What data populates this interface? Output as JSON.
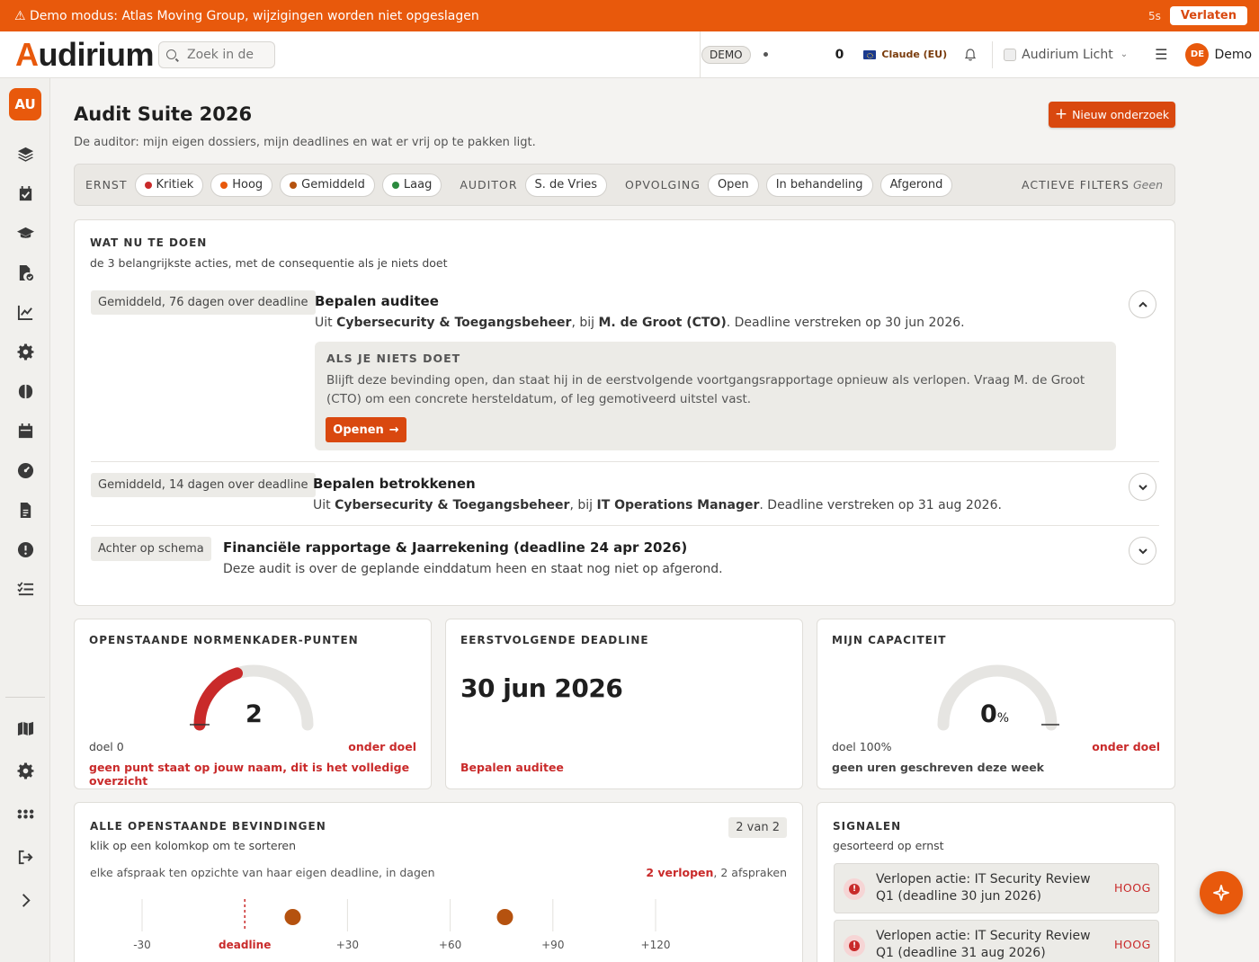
{
  "banner": {
    "message": "⚠ Demo modus: Atlas Moving Group, wijzigingen worden niet opgeslagen",
    "timer": "5s",
    "leave_label": "Verlaten"
  },
  "topbar": {
    "logo_first": "A",
    "logo_rest": "udirium",
    "search_placeholder": "Zoek in de",
    "demo_badge": "DEMO",
    "count": "0",
    "model": "Claude (EU)",
    "theme": "Audirium Licht",
    "user_initials": "DE",
    "user_name": "Demo"
  },
  "sidebar": {
    "badge": "AU",
    "items": [
      "layers-icon",
      "calendar-check-icon",
      "graduation-cap-icon",
      "file-check-icon",
      "chart-line-icon",
      "gear-icon",
      "brain-icon",
      "calendar-icon",
      "gauge-icon",
      "document-icon",
      "alert-circle-icon",
      "list-check-icon"
    ],
    "bottom_items": [
      "map-icon",
      "gear-icon",
      "grid-dots-icon",
      "sign-out-icon",
      "chevron-right-icon"
    ]
  },
  "page": {
    "title": "Audit Suite 2026",
    "subtitle": "De auditor: mijn eigen dossiers, mijn deadlines en wat er vrij op te pakken ligt.",
    "new_button": "Nieuw onderzoek"
  },
  "filters": {
    "severity_label": "ERNST",
    "severity": [
      {
        "label": "Kritiek",
        "color": "#c92a2a"
      },
      {
        "label": "Hoog",
        "color": "#e8590c"
      },
      {
        "label": "Gemiddeld",
        "color": "#b5520f"
      },
      {
        "label": "Laag",
        "color": "#2b8a3e"
      }
    ],
    "auditor_label": "AUDITOR",
    "auditor": "S. de Vries",
    "followup_label": "OPVOLGING",
    "followup": [
      "Open",
      "In behandeling",
      "Afgerond"
    ],
    "active_label": "ACTIEVE FILTERS",
    "active_value": "Geen"
  },
  "todo": {
    "heading": "WAT NU TE DOEN",
    "subheading": "de 3 belangrijkste acties, met de consequentie als je niets doet",
    "items": [
      {
        "tag": "Gemiddeld, 76 dagen over deadline",
        "title": "Bepalen auditee",
        "desc_prefix": "Uit ",
        "desc_source": "Cybersecurity & Toegangsbeheer",
        "desc_mid": ", bij ",
        "desc_owner": "M. de Groot (CTO)",
        "desc_suffix": ". Deadline verstreken op 30 jun 2026."
      },
      {
        "tag": "Gemiddeld, 14 dagen over deadline",
        "title": "Bepalen betrokkenen",
        "desc_prefix": "Uit ",
        "desc_source": "Cybersecurity & Toegangsbeheer",
        "desc_mid": ", bij ",
        "desc_owner": "IT Operations Manager",
        "desc_suffix": ". Deadline verstreken op 31 aug 2026."
      },
      {
        "tag": "Achter op schema",
        "title": "Financiële rapportage & Jaarrekening (deadline 24 apr 2026)",
        "desc": "Deze audit is over de geplande einddatum heen en staat nog niet op afgerond."
      }
    ],
    "consequence_heading": "ALS JE NIETS DOET",
    "consequence_text": "Blijft deze bevinding open, dan staat hij in de eerstvolgende voortgangsrapportage opnieuw als verlopen. Vraag M. de Groot (CTO) om een concrete hersteldatum, of leg gemotiveerd uitstel vast.",
    "open_label": "Openen"
  },
  "metrics": {
    "norms": {
      "heading": "OPENSTAANDE NORMENKADER-PUNTEN",
      "value": "2",
      "gauge_fill": 0.4,
      "goal": "doel 0",
      "status": "onder doel",
      "note": "geen punt staat op jouw naam, dit is het volledige overzicht"
    },
    "deadline": {
      "heading": "EERSTVOLGENDE DEADLINE",
      "value": "30 jun 2026",
      "note": "Bepalen auditee"
    },
    "capacity": {
      "heading": "MIJN CAPACITEIT",
      "value": "0",
      "unit": "%",
      "gauge_fill": 0,
      "goal": "doel 100%",
      "status": "onder doel",
      "note": "geen uren geschreven deze week"
    }
  },
  "findings": {
    "heading": "ALLE OPENSTAANDE BEVINDINGEN",
    "subheading": "klik op een kolomkop om te sorteren",
    "count_badge": "2 van 2",
    "chart_caption": "elke afspraak ten opzichte van haar eigen deadline, in dagen",
    "overdue": "2 verlopen",
    "total": ", 2 afspraken"
  },
  "chart_data": {
    "type": "scatter",
    "x_ticks": [
      -30,
      0,
      30,
      60,
      90,
      120
    ],
    "x_tick_labels": [
      "-30",
      "deadline",
      "+30",
      "+60",
      "+90",
      "+120"
    ],
    "xlim": [
      -30,
      120
    ],
    "points": [
      14,
      76
    ],
    "color": "#b5520f"
  },
  "signals": {
    "heading": "SIGNALEN",
    "subheading": "gesorteerd op ernst",
    "items": [
      {
        "text": "Verlopen actie: IT Security Review Q1 (deadline 30 jun 2026)",
        "level": "HOOG"
      },
      {
        "text": "Verlopen actie: IT Security Review Q1 (deadline 31 aug 2026)",
        "level": "HOOG"
      }
    ]
  }
}
